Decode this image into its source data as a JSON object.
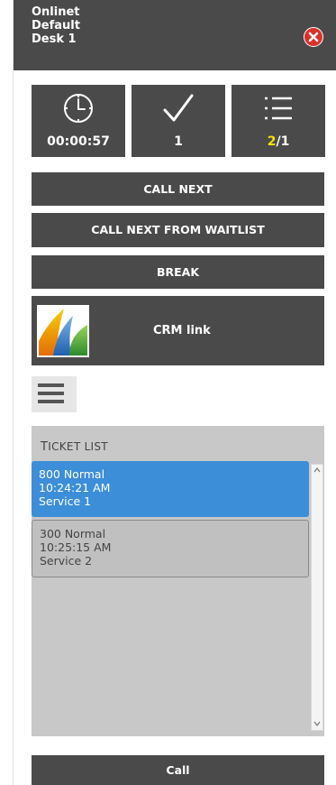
{
  "header": {
    "line1": "Onlinet",
    "line2": "Default",
    "line3": "Desk 1"
  },
  "stats": {
    "timer": "00:00:57",
    "served": "1",
    "queue_waiting": "2",
    "queue_sep": "/",
    "queue_total": "1"
  },
  "actions": {
    "call_next": "CALL NEXT",
    "call_next_waitlist": "CALL NEXT FROM WAITLIST",
    "break": "BREAK",
    "crm_link": "CRM link"
  },
  "ticket_list": {
    "title_first": "T",
    "title_rest": "ICKET LIST",
    "tickets": [
      {
        "line1": "800 Normal",
        "line2": "10:24:21 AM",
        "line3": "Service 1",
        "selected": true
      },
      {
        "line1": "300 Normal",
        "line2": "10:25:15 AM",
        "line3": "Service 2",
        "selected": false
      }
    ]
  },
  "footer": {
    "call": "Call"
  },
  "colors": {
    "dark": "#4a4a4a",
    "selected": "#3d8ed8",
    "close": "#d9322b",
    "highlight": "#f5e400"
  },
  "icons": [
    "clock-icon",
    "checkmark-icon",
    "list-icon",
    "close-icon",
    "hamburger-icon"
  ]
}
